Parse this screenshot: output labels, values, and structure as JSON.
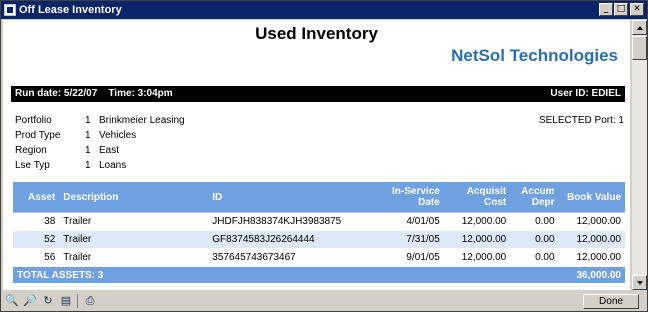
{
  "window": {
    "title": "Off Lease Inventory"
  },
  "report": {
    "title": "Used Inventory",
    "brand": "NetSol Technologies",
    "run_info": "Run date: 5/22/07    Time: 3:04pm",
    "user_id": "User ID: EDIEL",
    "selected_port": "SELECTED Port: 1",
    "params": [
      {
        "label": "Portfolio",
        "num": "1",
        "value": "Brinkmeier Leasing"
      },
      {
        "label": "Prod Type",
        "num": "1",
        "value": "Vehicles"
      },
      {
        "label": "Region",
        "num": "1",
        "value": "East"
      },
      {
        "label": "Lse Typ",
        "num": "1",
        "value": "Loans"
      }
    ]
  },
  "table": {
    "headers": {
      "asset": "Asset",
      "description": "Description",
      "id": "ID",
      "in_service_date": "In-Service Date",
      "acquisit_cost": "Acquisit Cost",
      "accum_depr": "Accum Depr",
      "book_value": "Book Value"
    },
    "rows": [
      {
        "asset": "38",
        "description": "Trailer",
        "id": "JHDFJH838374KJH3983875",
        "date": "4/01/05",
        "cost": "12,000.00",
        "depr": "0.00",
        "book": "12,000.00"
      },
      {
        "asset": "52",
        "description": "Trailer",
        "id": "GF8374583J26264444",
        "date": "7/31/05",
        "cost": "12,000.00",
        "depr": "0.00",
        "book": "12,000.00"
      },
      {
        "asset": "56",
        "description": "Trailer",
        "id": "357645743673467",
        "date": "9/01/05",
        "cost": "12,000.00",
        "depr": "0.00",
        "book": "12,000.00"
      }
    ],
    "footer": {
      "label": "TOTAL ASSETS: 3",
      "total": "36,000.00"
    }
  },
  "statusbar": {
    "done_label": "Done"
  },
  "icons": [
    "zoom-out-icon",
    "zoom-in-icon",
    "refresh-icon",
    "print-preview-icon",
    "print-icon"
  ]
}
